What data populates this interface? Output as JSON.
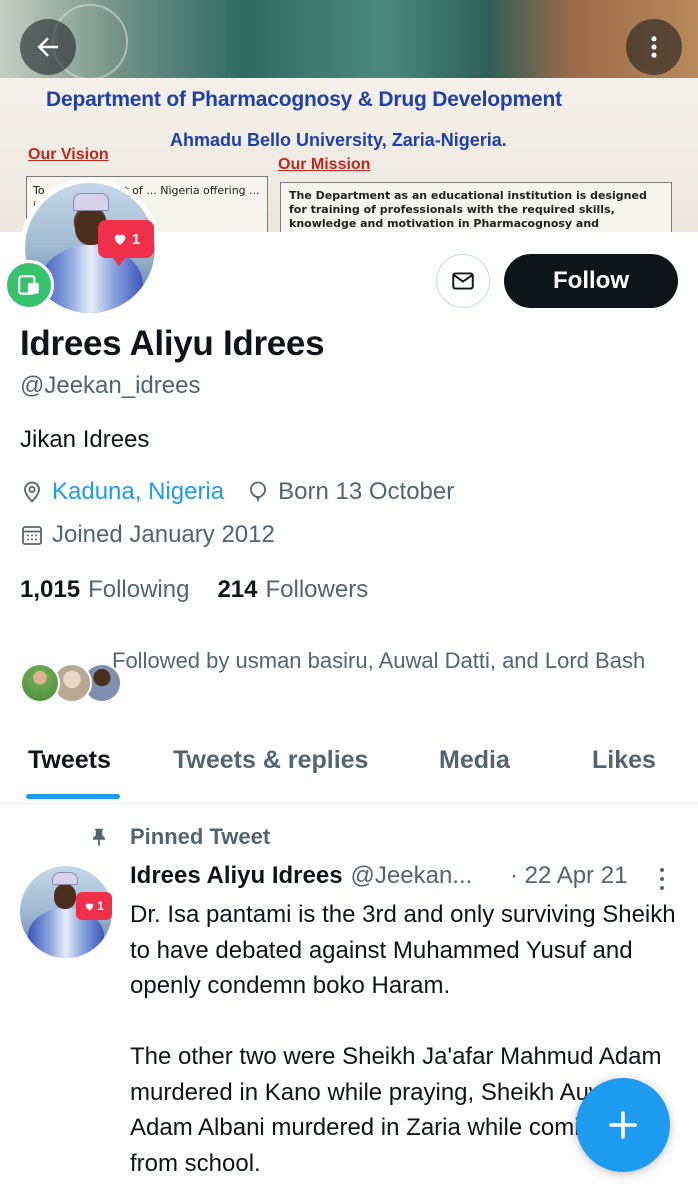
{
  "banner": {
    "dept_title": "Department of Pharmacognosy & Drug Development",
    "dept_sub": "Ahmadu Bello University, Zaria-Nigeria.",
    "vision_title": "Our Vision",
    "vision_text": "To ... Department of ... Nigeria offering ... ic programmes,",
    "mission_title": "Our Mission",
    "mission_text": "The Department as an educational institution is designed for training of professionals with the required skills, knowledge and motivation in Pharmacognosy and Pharmaceutical services"
  },
  "nav": {
    "back_icon": "arrow-left-icon",
    "more_icon": "vertical-dots-icon"
  },
  "profile": {
    "like_count": "1",
    "name": "Idrees Aliyu Idrees",
    "handle": "@Jeekan_idrees",
    "bio": "Jikan Idrees",
    "location": "Kaduna, Nigeria",
    "birthday": "Born 13 October",
    "joined": "Joined January 2012",
    "following_count": "1,015",
    "following_label": "Following",
    "followers_count": "214",
    "followers_label": "Followers",
    "followed_by": "Followed by usman basiru, Auwal Datti, and Lord Bash"
  },
  "actions": {
    "follow_label": "Follow",
    "message_icon": "envelope-icon"
  },
  "tabs": [
    {
      "label": "Tweets",
      "active": true
    },
    {
      "label": "Tweets & replies",
      "active": false
    },
    {
      "label": "Media",
      "active": false
    },
    {
      "label": "Likes",
      "active": false
    }
  ],
  "pinned_tweet": {
    "pinned_label": "Pinned Tweet",
    "author_name": "Idrees Aliyu Idrees",
    "author_handle": "@Jeekan...",
    "date": "· 22 Apr 21",
    "like_count": "1",
    "text": "Dr. Isa pantami is the 3rd and only surviving Sheikh to have debated against Muhammed Yusuf and openly condemn boko Haram.\n\nThe other two were Sheikh Ja'afar Mahmud Adam murdered in Kano while praying, Sheikh Auwal Adam Albani murdered in Zaria while coming back from school."
  },
  "colors": {
    "accent": "#1d9bf0",
    "text": "#0f1419",
    "secondary": "#536471",
    "like_red": "#f0304a"
  }
}
